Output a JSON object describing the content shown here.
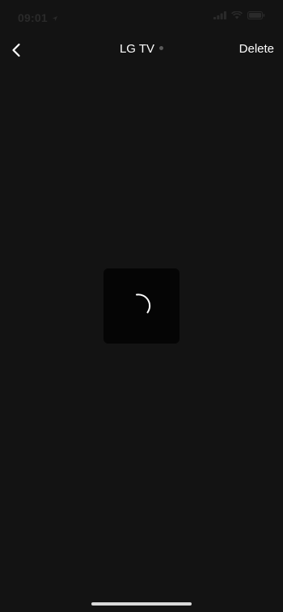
{
  "status_bar": {
    "time": "09:01",
    "icons": [
      "location-arrow-icon",
      "signal-icon",
      "wifi-icon",
      "battery-icon"
    ]
  },
  "nav": {
    "back_icon": "chevron-left-icon",
    "title": "LG TV",
    "connection_dot_color": "#5a5a5a",
    "delete_label": "Delete"
  },
  "loading": {
    "icon": "spinner-icon"
  },
  "colors": {
    "background": "#131313",
    "text": "#ffffff",
    "loading_box": "#050505"
  }
}
